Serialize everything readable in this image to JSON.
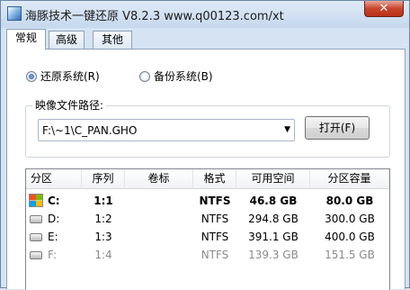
{
  "window": {
    "title": "海豚技术一键还原 V8.2.3 www.q00123.com/xt",
    "close_glyph": "✕"
  },
  "tabs": [
    {
      "label": "常规",
      "active": true
    },
    {
      "label": "高级",
      "active": false
    },
    {
      "label": "其他",
      "active": false
    }
  ],
  "mode": {
    "restore_label": "还原系统(R)",
    "backup_label": "备份系统(B)",
    "selected": "restore"
  },
  "image_path": {
    "legend": "映像文件路径:",
    "value": "F:\\~1\\C_PAN.GHO",
    "open_button": "打开(F)"
  },
  "partition_table": {
    "headers": [
      "分区",
      "序列",
      "卷标",
      "格式",
      "可用空间",
      "分区容量"
    ],
    "rows": [
      {
        "drive": "C:",
        "seq": "1:1",
        "label": "",
        "format": "NTFS",
        "free": "46.8 GB",
        "capacity": "80.0 GB",
        "icon": "windows-drive-icon",
        "bold": true,
        "dim": false
      },
      {
        "drive": "D:",
        "seq": "1:2",
        "label": "",
        "format": "NTFS",
        "free": "294.8 GB",
        "capacity": "300.0 GB",
        "icon": "drive-icon",
        "bold": false,
        "dim": false
      },
      {
        "drive": "E:",
        "seq": "1:3",
        "label": "",
        "format": "NTFS",
        "free": "391.1 GB",
        "capacity": "400.0 GB",
        "icon": "drive-icon",
        "bold": false,
        "dim": false
      },
      {
        "drive": "F:",
        "seq": "1:4",
        "label": "",
        "format": "NTFS",
        "free": "139.3 GB",
        "capacity": "151.5 GB",
        "icon": "drive-icon",
        "bold": false,
        "dim": true
      }
    ]
  }
}
